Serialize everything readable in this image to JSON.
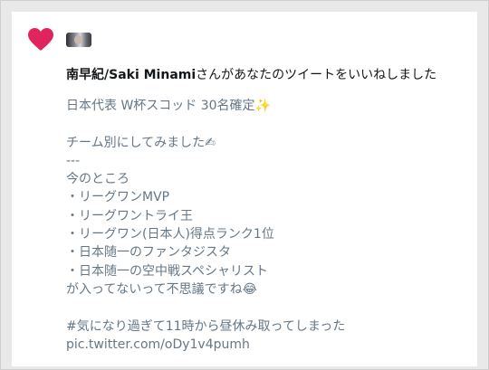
{
  "notification": {
    "icon": "heart-icon",
    "icon_color": "#e0245e",
    "avatar": "user-avatar",
    "user_name": "南早紀/Saki Minami",
    "action_text": "さんがあなたのツイートをいいねしました"
  },
  "tweet": {
    "lines": [
      "日本代表 W杯スコッド 30名確定✨",
      "",
      "チーム別にしてみました✍",
      "---",
      "今のところ",
      "・リーグワンMVP",
      "・リーグワントライ王",
      "・リーグワン(日本人)得点ランク1位",
      "・日本随一のファンタジスタ",
      "・日本随一の空中戦スペシャリスト",
      "が入ってないって不思議ですね😂",
      "",
      "#気になり過ぎて11時から昼休み取ってしまった",
      "pic.twitter.com/oDy1v4pumh"
    ],
    "text_color": "#657786"
  }
}
